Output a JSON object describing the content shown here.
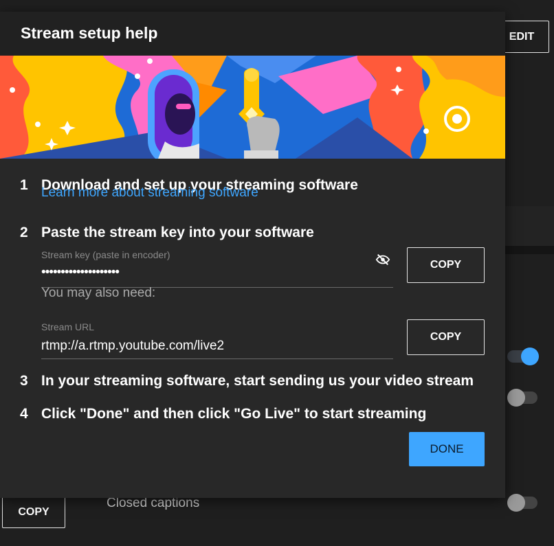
{
  "background": {
    "edit_label": "EDIT",
    "copy_label": "COPY",
    "closed_captions_label": "Closed captions",
    "toggles": [
      {
        "name": "toggle-1",
        "on": true
      },
      {
        "name": "toggle-2",
        "on": false
      },
      {
        "name": "closed-captions-toggle",
        "on": false
      }
    ]
  },
  "dialog": {
    "title": "Stream setup help",
    "steps": [
      {
        "number": "1",
        "text": "Download and set up your streaming software"
      },
      {
        "number": "2",
        "text": "Paste the stream key into your software"
      },
      {
        "number": "3",
        "text": "In your streaming software, start sending us your video stream"
      },
      {
        "number": "4",
        "text": "Click \"Done\" and then click \"Go Live\" to start streaming"
      }
    ],
    "learn_more_link": "Learn more about streaming software",
    "stream_key": {
      "label": "Stream key (paste in encoder)",
      "value": "••••••••••••••••••••",
      "copy_label": "COPY",
      "visibility_icon": "eye-off-icon"
    },
    "also_need": "You may also need:",
    "stream_url": {
      "label": "Stream URL",
      "value": "rtmp://a.rtmp.youtube.com/live2",
      "copy_label": "COPY"
    },
    "done_label": "DONE"
  },
  "colors": {
    "accent": "#3ea6ff",
    "dialog_bg": "#282828",
    "header_bg": "#212121",
    "page_bg": "#1f1f1f"
  }
}
